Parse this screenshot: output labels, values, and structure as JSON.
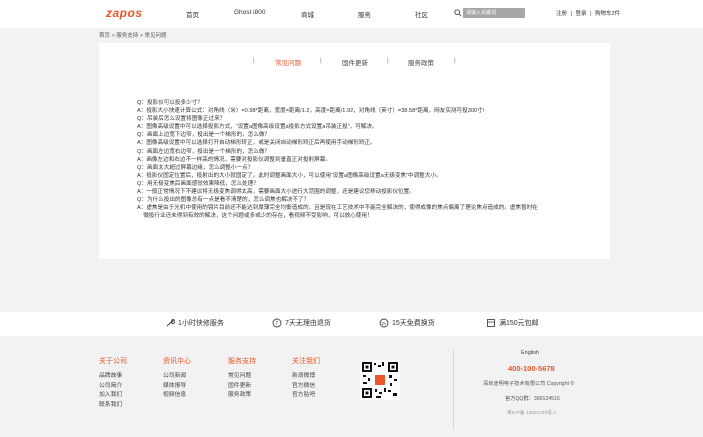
{
  "header": {
    "logo": "zapos",
    "nav": [
      "首页",
      "Ghost i800",
      "商城",
      "服务",
      "社区"
    ],
    "search_placeholder": "请输入关键词",
    "links": [
      "注册",
      "|",
      "登录",
      "|",
      "购物车2件"
    ]
  },
  "breadcrumb": "首页 > 服务支持 > 常见问题",
  "tabs": {
    "items": [
      "常见问题",
      "固件更新",
      "服务政策"
    ],
    "separator": "|",
    "active_index": 0
  },
  "faq": [
    "Q：投影仪可以投多少寸？",
    "A：投影大小快速计算公式：对角线（米）=0.98*距离，宽度=距离/1.2，高度=距离/1.92，对角线（英寸）=38.58*距离，网友实测可投300寸!",
    "Q：吊装后怎么设置将图像正过来？",
    "A：图像高级设置中可以选择投影方式，“设置a图像高级设置a投影方式设置a吊装正投”，可解决。",
    "Q：画面上边宽下边窄，投出是一个梯形的，怎么做？",
    "A：图像高级设置中可以选择打开自动梯形矫正，或是关闭自动梯形矫正后再使用手动梯形矫正。",
    "Q：画面左边宽右边窄，投出是一个梯形的，怎么做？",
    "A：画像左边和右边不一样高的情况，需要对投影仪调整到垂直正对投射屏幕。",
    "Q：画面太大超过屏幕边缘，怎么调整小一点？",
    "A：投影仪固定位置后，投射出的大小就固定了。此时调整画面大小，可以使用“设置a图像高级设置a无极变焦”中调整大小。",
    "Q：用无极变焦后画面感觉效果降低，怎么处理？",
    "A：一般正常情况下不建议将无极变焦调得太高，需要画面大小进行大范围的调整，还是建议您移动投影仪位置。",
    "Q：为什么投出的图像总有一点是看不清楚的，怎么调焦也解决不了？",
    "A：虚焦是由于光机中使用的镜片目前还不能达到厚薄完全均衡造成的，且是现在工艺技术中不能完全解决的，使得成像的焦点偏离了理论焦点造成的。虚焦暂时在",
    "    微投行业还未得到有效的解决，这个问题或多或少的存在，看视频不受影响，可以放心使用！"
  ],
  "services": [
    {
      "icon": "wrench-icon",
      "label": "1小时快修服务"
    },
    {
      "icon": "return-7-icon",
      "label": "7天无理由退货"
    },
    {
      "icon": "exchange-15-icon",
      "label": "15天免费换货"
    },
    {
      "icon": "shipping-icon",
      "label": "满150元包邮"
    }
  ],
  "footer": {
    "columns": [
      {
        "title": "关于公司",
        "links": [
          "品牌故事",
          "公司简介",
          "加入我们",
          "联系我们"
        ]
      },
      {
        "title": "资讯中心",
        "links": [
          "公司新闻",
          "媒体报导",
          "视频信息"
        ]
      },
      {
        "title": "服务支持",
        "links": [
          "常见问题",
          "固件更新",
          "服务政策"
        ]
      },
      {
        "title": "关注我们",
        "links": [
          "新浪微博",
          "官方微信",
          "官方贴吧"
        ]
      }
    ],
    "language": "English",
    "phone": "400-100-5678",
    "copyright": "深圳途明电子技术有限公司 Copyright ©",
    "qq": "官方QQ群：390124516",
    "icp": "粤ICP备 14001720号-1"
  },
  "colors": {
    "accent": "#e8562a",
    "background": "#f2f2f2"
  }
}
